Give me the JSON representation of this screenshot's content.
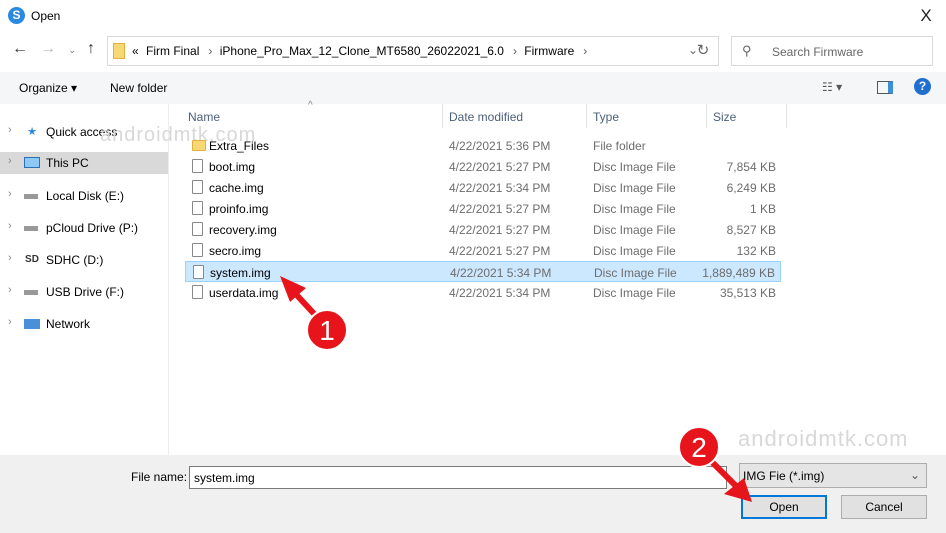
{
  "window": {
    "title": "Open",
    "close_label": "X",
    "app_icon_letter": "S"
  },
  "address": {
    "crumbs": [
      "Firm Final",
      "iPhone_Pro_Max_12_Clone_MT6580_26022021_6.0",
      "Firmware"
    ],
    "overflow": "«"
  },
  "search": {
    "placeholder": "Search Firmware"
  },
  "toolbar": {
    "organize": "Organize ▾",
    "new_folder": "New folder",
    "help": "?"
  },
  "nav": [
    {
      "label": "Quick access",
      "icon": "star-icon"
    },
    {
      "label": "This PC",
      "icon": "computer-icon",
      "selected": true
    },
    {
      "label": "Local Disk (E:)",
      "icon": "drive-icon"
    },
    {
      "label": "pCloud Drive (P:)",
      "icon": "drive-icon"
    },
    {
      "label": "SDHC (D:)",
      "icon": "sd-card-icon"
    },
    {
      "label": "USB Drive (F:)",
      "icon": "usb-drive-icon"
    },
    {
      "label": "Network",
      "icon": "network-icon"
    }
  ],
  "columns": {
    "name": "Name",
    "date": "Date modified",
    "type": "Type",
    "size": "Size"
  },
  "files": [
    {
      "name": "Extra_Files",
      "date": "4/22/2021 5:36 PM",
      "type": "File folder",
      "size": ""
    },
    {
      "name": "boot.img",
      "date": "4/22/2021 5:27 PM",
      "type": "Disc Image File",
      "size": "7,854 KB"
    },
    {
      "name": "cache.img",
      "date": "4/22/2021 5:34 PM",
      "type": "Disc Image File",
      "size": "6,249 KB"
    },
    {
      "name": "proinfo.img",
      "date": "4/22/2021 5:27 PM",
      "type": "Disc Image File",
      "size": "1 KB"
    },
    {
      "name": "recovery.img",
      "date": "4/22/2021 5:27 PM",
      "type": "Disc Image File",
      "size": "8,527 KB"
    },
    {
      "name": "secro.img",
      "date": "4/22/2021 5:27 PM",
      "type": "Disc Image File",
      "size": "132 KB"
    },
    {
      "name": "system.img",
      "date": "4/22/2021 5:34 PM",
      "type": "Disc Image File",
      "size": "1,889,489 KB",
      "selected": true
    },
    {
      "name": "userdata.img",
      "date": "4/22/2021 5:34 PM",
      "type": "Disc Image File",
      "size": "35,513 KB"
    }
  ],
  "bottom": {
    "file_name_label": "File name:",
    "file_name_value": "system.img",
    "filter": "IMG Fie (*.img)",
    "open": "Open",
    "cancel": "Cancel"
  },
  "annotations": {
    "step1": "1",
    "step2": "2",
    "color": "#e8141b"
  },
  "watermark": "androidmtk.com"
}
